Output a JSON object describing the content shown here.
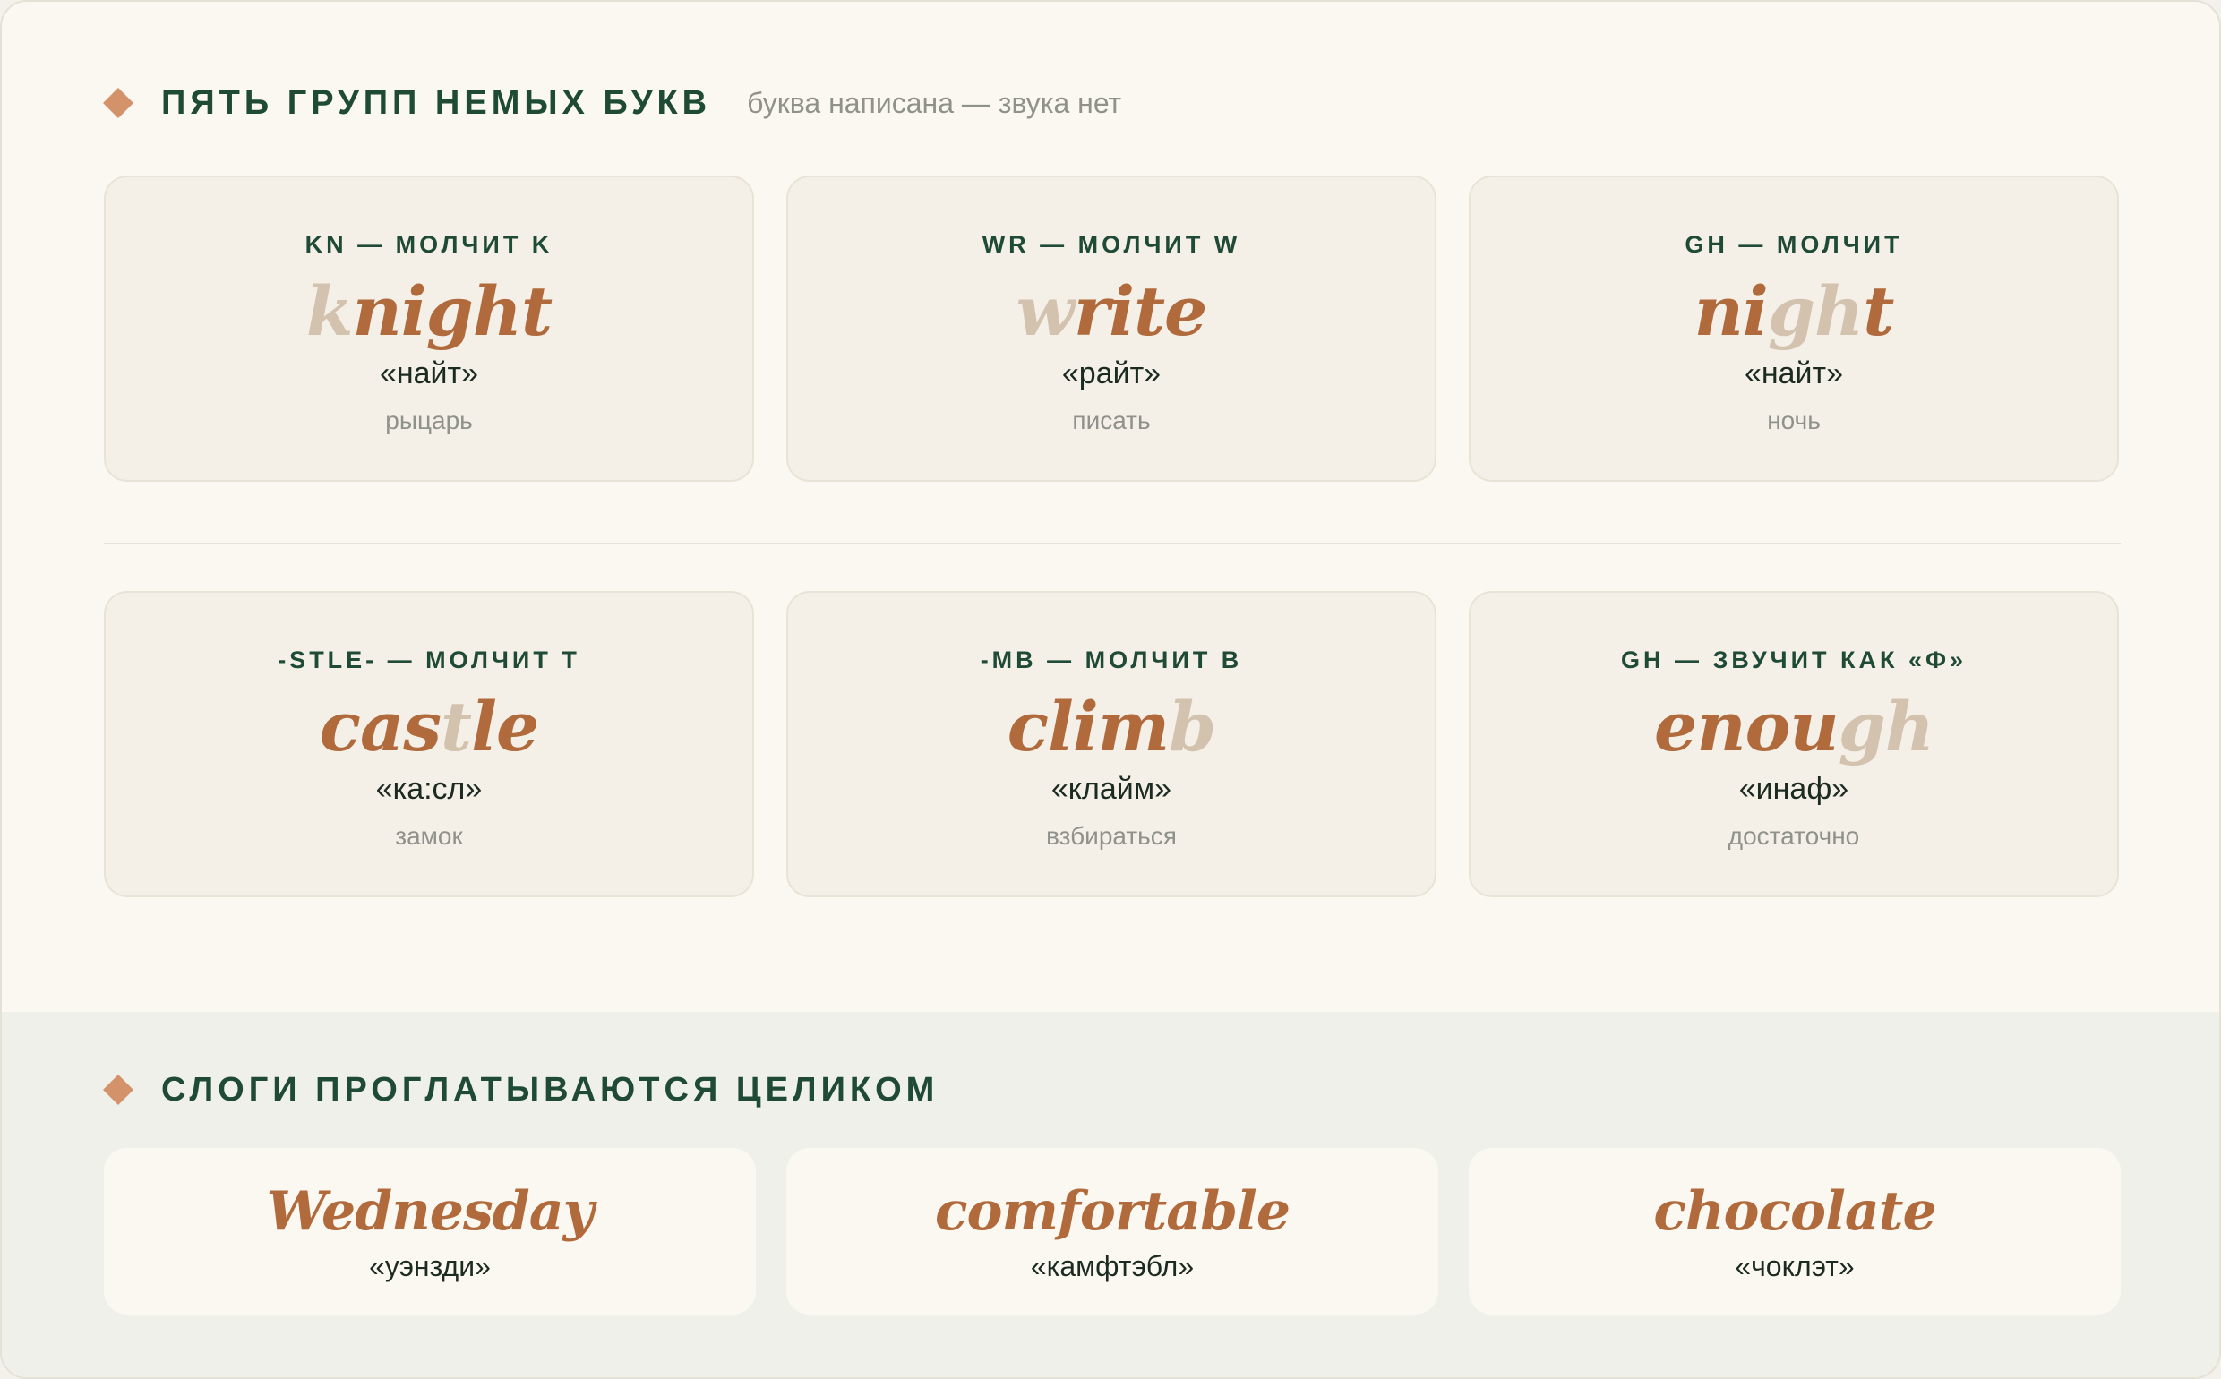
{
  "section1": {
    "title": "ПЯТЬ ГРУПП НЕМЫХ БУКВ",
    "subtitle": "буква написана — звука нет",
    "cards": [
      {
        "label": "KN — МОЛЧИТ K",
        "parts": [
          {
            "t": "k",
            "silent": true
          },
          {
            "t": "night",
            "silent": false
          }
        ],
        "pron": "«найт»",
        "trans": "рыцарь"
      },
      {
        "label": "WR — МОЛЧИТ W",
        "parts": [
          {
            "t": "w",
            "silent": true
          },
          {
            "t": "rite",
            "silent": false
          }
        ],
        "pron": "«райт»",
        "trans": "писать"
      },
      {
        "label": "GH — МОЛЧИТ",
        "parts": [
          {
            "t": "ni",
            "silent": false
          },
          {
            "t": "gh",
            "silent": true
          },
          {
            "t": "t",
            "silent": false
          }
        ],
        "pron": "«найт»",
        "trans": "ночь"
      },
      {
        "label": "-STLE- — МОЛЧИТ T",
        "parts": [
          {
            "t": "cas",
            "silent": false
          },
          {
            "t": "t",
            "silent": true
          },
          {
            "t": "le",
            "silent": false
          }
        ],
        "pron": "«ка:сл»",
        "trans": "замок"
      },
      {
        "label": "-MB — МОЛЧИТ B",
        "parts": [
          {
            "t": "clim",
            "silent": false
          },
          {
            "t": "b",
            "silent": true
          }
        ],
        "pron": "«клайм»",
        "trans": "взбираться"
      },
      {
        "label": "GH — ЗВУЧИТ КАК «Ф»",
        "parts": [
          {
            "t": "enou",
            "silent": false
          },
          {
            "t": "gh",
            "silent": true
          }
        ],
        "pron": "«инаф»",
        "trans": "достаточно"
      }
    ]
  },
  "section2": {
    "title": "СЛОГИ ПРОГЛАТЫВАЮТСЯ ЦЕЛИКОМ",
    "cards": [
      {
        "word": "Wednesday",
        "pron": "«уэнзди»"
      },
      {
        "word": "comfortable",
        "pron": "«камфтэбл»"
      },
      {
        "word": "chocolate",
        "pron": "«чоклэт»"
      }
    ]
  },
  "colors": {
    "heading": "#1f4a35",
    "accent_word": "#b06a3c",
    "silent_letter": "#d3c3ae",
    "diamond": "#d4926a"
  },
  "icons": [
    "diamond-bullet-icon"
  ]
}
